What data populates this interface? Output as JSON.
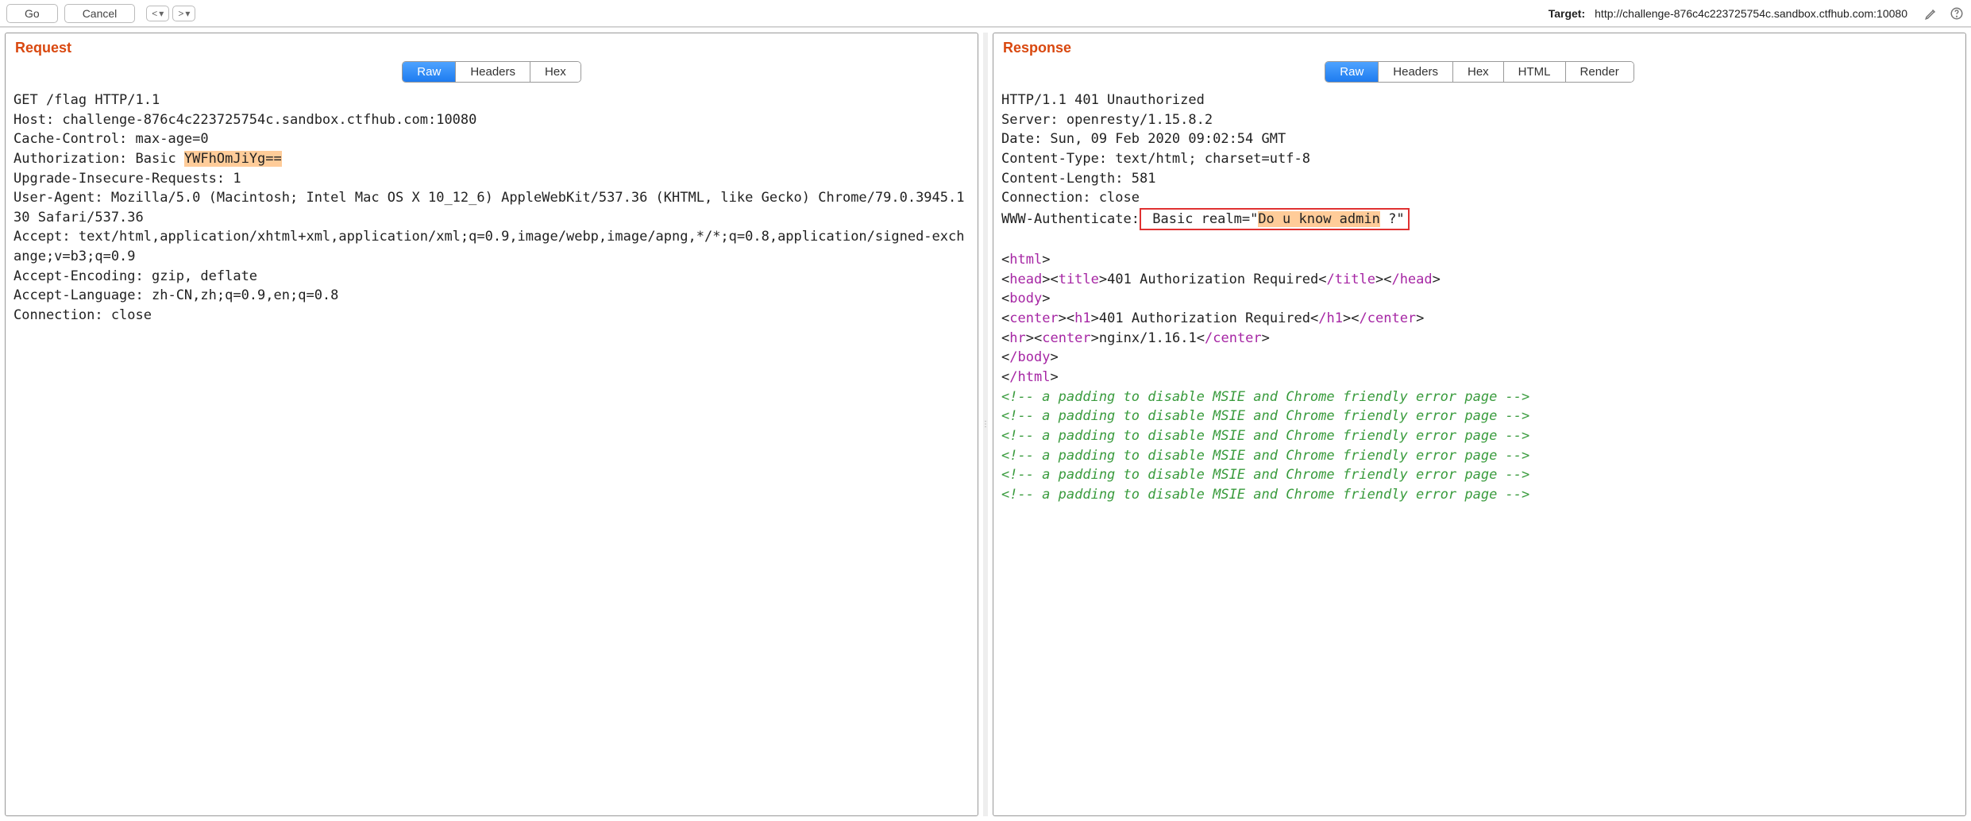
{
  "toolbar": {
    "go_label": "Go",
    "cancel_label": "Cancel",
    "prev_label": "<",
    "next_label": ">",
    "dropdown_glyph": "▾",
    "target_label": "Target:",
    "target_url": "http://challenge-876c4c223725754c.sandbox.ctfhub.com:10080"
  },
  "request": {
    "title": "Request",
    "tabs": {
      "raw": "Raw",
      "headers": "Headers",
      "hex": "Hex"
    },
    "lines": {
      "l0": "GET /flag HTTP/1.1",
      "l1": "Host: challenge-876c4c223725754c.sandbox.ctfhub.com:10080",
      "l2": "Cache-Control: max-age=0",
      "l3a": "Authorization: Basic ",
      "l3b": "YWFhOmJiYg==",
      "l4": "Upgrade-Insecure-Requests: 1",
      "l5": "User-Agent: Mozilla/5.0 (Macintosh; Intel Mac OS X 10_12_6) AppleWebKit/537.36 (KHTML, like Gecko) Chrome/79.0.3945.130 Safari/537.36",
      "l6": "Accept: text/html,application/xhtml+xml,application/xml;q=0.9,image/webp,image/apng,*/*;q=0.8,application/signed-exchange;v=b3;q=0.9",
      "l7": "Accept-Encoding: gzip, deflate",
      "l8": "Accept-Language: zh-CN,zh;q=0.9,en;q=0.8",
      "l9": "Connection: close"
    }
  },
  "response": {
    "title": "Response",
    "tabs": {
      "raw": "Raw",
      "headers": "Headers",
      "hex": "Hex",
      "html": "HTML",
      "render": "Render"
    },
    "lines": {
      "l0": "HTTP/1.1 401 Unauthorized",
      "l1": "Server: openresty/1.15.8.2",
      "l2": "Date: Sun, 09 Feb 2020 09:02:54 GMT",
      "l3": "Content-Type: text/html; charset=utf-8",
      "l4": "Content-Length: 581",
      "l5": "Connection: close",
      "l6a": "WWW-Authenticate:",
      "l6b": " Basic realm=\"",
      "l6c": "Do u know admin",
      "l6d": " ?\"",
      "html_open": "<",
      "html_close": ">",
      "slash": "/",
      "t_html": "html",
      "t_head": "head",
      "t_title": "title",
      "t_body": "body",
      "t_center": "center",
      "t_h1": "h1",
      "t_hr": "hr",
      "title_text": "401 Authorization Required",
      "h1_text": "401 Authorization Required",
      "nginx_text": "nginx/1.16.1",
      "comment_text": "<!-- a padding to disable MSIE and Chrome friendly error page -->"
    }
  }
}
